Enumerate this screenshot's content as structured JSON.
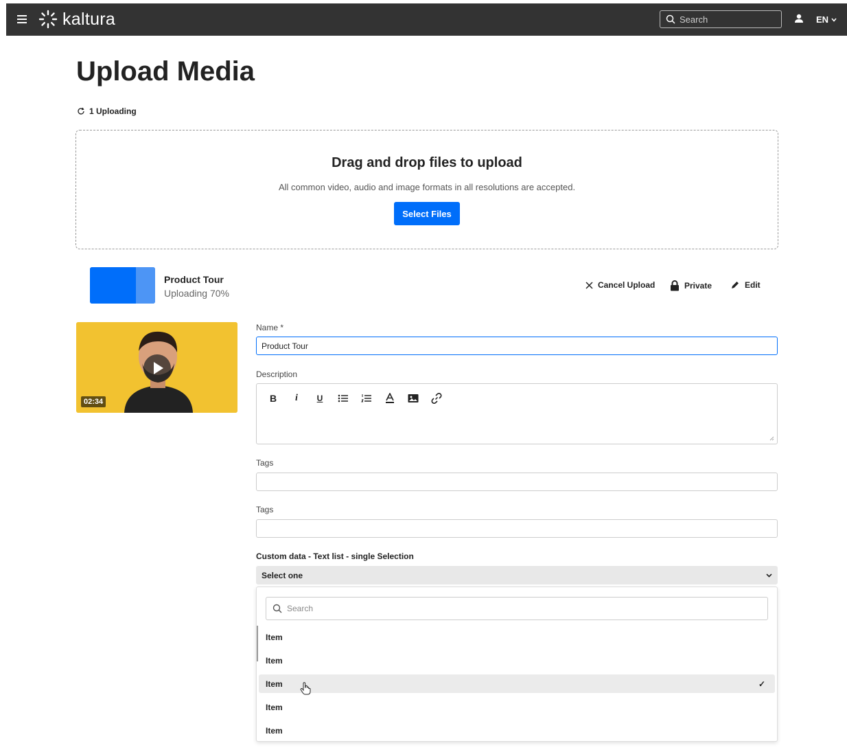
{
  "header": {
    "logo_text": "kaltura",
    "search_placeholder": "Search",
    "language": "EN"
  },
  "page": {
    "title": "Upload Media",
    "uploading_count": "1 Uploading"
  },
  "dropzone": {
    "title": "Drag and drop files to upload",
    "subtitle": "All common video, audio and image formats in all resolutions are accepted.",
    "button_label": "Select Files"
  },
  "upload_item": {
    "name": "Product Tour",
    "status": "Uploading 70%",
    "progress": 0.7,
    "actions": {
      "cancel": "Cancel Upload",
      "privacy": "Private",
      "edit": "Edit"
    }
  },
  "thumbnail": {
    "duration": "02:34"
  },
  "form": {
    "name_label": "Name *",
    "name_value": "Product Tour",
    "description_label": "Description",
    "tags_label_1": "Tags",
    "tags_label_2": "Tags",
    "custom_label": "Custom data - Text list -  single Selection",
    "select_value": "Select one"
  },
  "dropdown": {
    "search_placeholder": "Search",
    "items": [
      {
        "label": "Item",
        "selected": false
      },
      {
        "label": "Item",
        "selected": false
      },
      {
        "label": "Item",
        "selected": true
      },
      {
        "label": "Item",
        "selected": false
      },
      {
        "label": "Item",
        "selected": false
      }
    ],
    "check": "✓"
  },
  "colors": {
    "accent": "#006EFA",
    "topbar": "#333333",
    "thumbnail_bg": "#F2C230"
  }
}
